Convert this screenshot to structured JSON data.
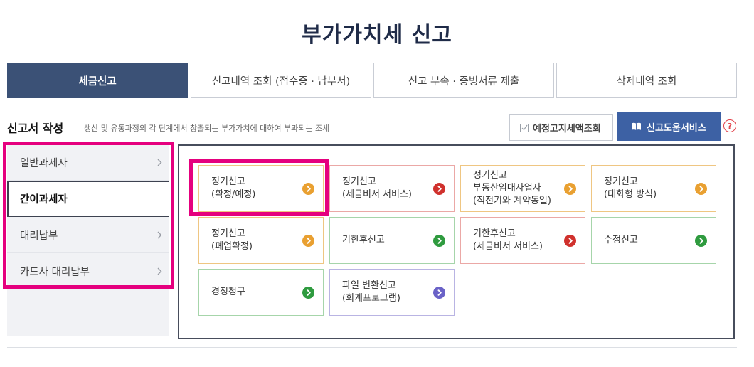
{
  "page_title": "부가가치세 신고",
  "tabs": [
    {
      "label": "세금신고",
      "active": true
    },
    {
      "label": "신고내역 조회 (접수증 · 납부서)",
      "active": false
    },
    {
      "label": "신고 부속 · 증빙서류 제출",
      "active": false
    },
    {
      "label": "삭제내역 조회",
      "active": false
    }
  ],
  "section": {
    "title": "신고서 작성",
    "description": "생산 및 유통과정의 각 단계에서 창출되는 부가가치에 대하여 부과되는 조세"
  },
  "actions": {
    "notice_lookup_label": "예정고지세액조회",
    "notice_lookup_icon": "checklist-icon",
    "help_service_label": "신고도움서비스",
    "help_service_icon": "book-icon",
    "help_icon": "question-circle-icon",
    "help_icon_glyph": "?"
  },
  "sidebar": {
    "chevron_icon": "chevron-right-icon",
    "items": [
      {
        "label": "일반과세자",
        "active": false
      },
      {
        "label": "간이과세자",
        "active": true
      },
      {
        "label": "대리납부",
        "active": false
      },
      {
        "label": "카드사 대리납부",
        "active": false
      }
    ]
  },
  "card_icon": "chevron-right-circle-icon",
  "cards": [
    {
      "label": "정기신고\n(확정/예정)",
      "accent": "orange"
    },
    {
      "label": "정기신고\n(세금비서 서비스)",
      "accent": "red"
    },
    {
      "label": "정기신고\n부동산임대사업자\n(직전기와 계약동일)",
      "accent": "orange"
    },
    {
      "label": "정기신고\n(대화형 방식)",
      "accent": "orange"
    },
    {
      "label": "정기신고\n(폐업확정)",
      "accent": "orange"
    },
    {
      "label": "기한후신고",
      "accent": "green"
    },
    {
      "label": "기한후신고\n(세금비서 서비스)",
      "accent": "red"
    },
    {
      "label": "수정신고",
      "accent": "green"
    },
    {
      "label": "경정청구",
      "accent": "green"
    },
    {
      "label": "파일 변환신고\n(회계프로그램)",
      "accent": "purple"
    }
  ],
  "colors": {
    "title": "#1f2b48",
    "tab_active_bg": "#3b5176",
    "tab_border": "#c9cdd5",
    "help_button_bg": "#3d61a4",
    "help_icon": "#e2434b",
    "sidebar_bg": "#f1f2f5",
    "panel_border": "#474d5c",
    "highlight": "#e5007e",
    "accent_orange": "#e9a031",
    "accent_orange_border": "#efc682",
    "accent_red": "#d0312d",
    "accent_red_border": "#eba8a6",
    "accent_green": "#2f9b3f",
    "accent_green_border": "#a6d5aa",
    "accent_purple": "#6a62c7",
    "accent_purple_border": "#b9b4e3"
  }
}
